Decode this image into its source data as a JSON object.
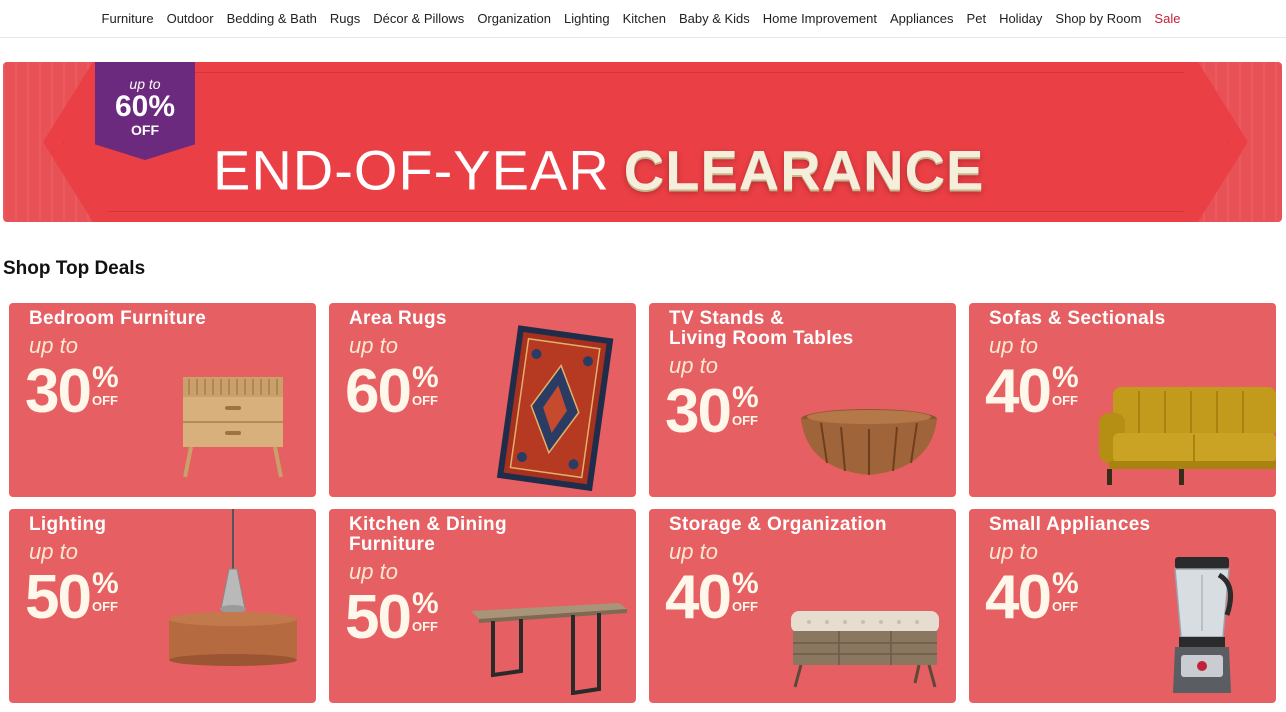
{
  "nav": {
    "items": [
      {
        "label": "Furniture"
      },
      {
        "label": "Outdoor"
      },
      {
        "label": "Bedding & Bath"
      },
      {
        "label": "Rugs"
      },
      {
        "label": "Décor & Pillows"
      },
      {
        "label": "Organization"
      },
      {
        "label": "Lighting"
      },
      {
        "label": "Kitchen"
      },
      {
        "label": "Baby & Kids"
      },
      {
        "label": "Home Improvement"
      },
      {
        "label": "Appliances"
      },
      {
        "label": "Pet"
      },
      {
        "label": "Holiday"
      },
      {
        "label": "Shop by Room"
      },
      {
        "label": "Sale"
      }
    ]
  },
  "banner": {
    "badge_up_to": "up to",
    "badge_percent": "60%",
    "badge_off": "OFF",
    "title_part1": "END-OF-YEAR",
    "title_part2": "CLEARANCE"
  },
  "section": {
    "title": "Shop Top Deals"
  },
  "deals": [
    {
      "name_line1": "Bedroom Furniture",
      "name_line2": "",
      "up_to": "up to",
      "percent": "30",
      "percent_sign": "%",
      "off": "OFF",
      "image_icon": "nightstand-icon"
    },
    {
      "name_line1": "Area Rugs",
      "name_line2": "",
      "up_to": "up to",
      "percent": "60",
      "percent_sign": "%",
      "off": "OFF",
      "image_icon": "rug-icon"
    },
    {
      "name_line1": "TV Stands &",
      "name_line2": "Living Room Tables",
      "up_to": "up to",
      "percent": "30",
      "percent_sign": "%",
      "off": "OFF",
      "image_icon": "coffee-table-icon"
    },
    {
      "name_line1": "Sofas & Sectionals",
      "name_line2": "",
      "up_to": "up to",
      "percent": "40",
      "percent_sign": "%",
      "off": "OFF",
      "image_icon": "sofa-icon"
    },
    {
      "name_line1": "Lighting",
      "name_line2": "",
      "up_to": "up to",
      "percent": "50",
      "percent_sign": "%",
      "off": "OFF",
      "image_icon": "pendant-lamp-icon"
    },
    {
      "name_line1": "Kitchen & Dining",
      "name_line2": "Furniture",
      "up_to": "up to",
      "percent": "50",
      "percent_sign": "%",
      "off": "OFF",
      "image_icon": "dining-table-icon"
    },
    {
      "name_line1": "Storage & Organization",
      "name_line2": "",
      "up_to": "up to",
      "percent": "40",
      "percent_sign": "%",
      "off": "OFF",
      "image_icon": "storage-bench-icon"
    },
    {
      "name_line1": "Small Appliances",
      "name_line2": "",
      "up_to": "up to",
      "percent": "40",
      "percent_sign": "%",
      "off": "OFF",
      "image_icon": "blender-icon"
    }
  ],
  "colors": {
    "card_bg": "#e65f62",
    "banner_bg": "#e85256",
    "badge_bg": "#6b2a7e",
    "sale_link": "#c2213b"
  }
}
